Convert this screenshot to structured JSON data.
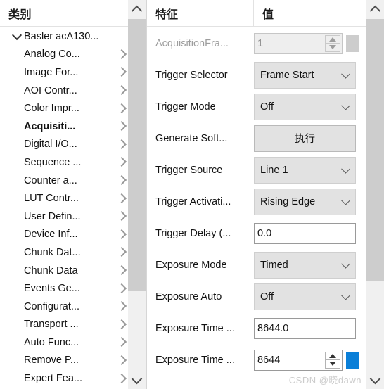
{
  "colors": {
    "accent_chip": "#0a7fd8",
    "scrollbar_thumb": "#cdcdcd",
    "scrollbar_track": "#f0f0f0",
    "combo_bg": "#e2e2e2",
    "text": "#121212",
    "disabled_text": "#9d9d9d"
  },
  "left_panel": {
    "header": "类别",
    "tree": [
      {
        "label": "Basler acA130...",
        "expander": "chevron-down",
        "has_children_arrow": false,
        "bold": false
      },
      {
        "label": "Analog Co...",
        "expander": "",
        "has_children_arrow": true,
        "bold": false
      },
      {
        "label": "Image For...",
        "expander": "",
        "has_children_arrow": true,
        "bold": false
      },
      {
        "label": "AOI Contr...",
        "expander": "",
        "has_children_arrow": true,
        "bold": false
      },
      {
        "label": "Color Impr...",
        "expander": "",
        "has_children_arrow": true,
        "bold": false
      },
      {
        "label": "Acquisiti...",
        "expander": "",
        "has_children_arrow": true,
        "bold": true
      },
      {
        "label": "Digital I/O...",
        "expander": "",
        "has_children_arrow": true,
        "bold": false
      },
      {
        "label": "Sequence ...",
        "expander": "",
        "has_children_arrow": true,
        "bold": false
      },
      {
        "label": "Counter a...",
        "expander": "",
        "has_children_arrow": true,
        "bold": false
      },
      {
        "label": "LUT Contr...",
        "expander": "",
        "has_children_arrow": true,
        "bold": false
      },
      {
        "label": "User Defin...",
        "expander": "",
        "has_children_arrow": true,
        "bold": false
      },
      {
        "label": "Device Inf...",
        "expander": "",
        "has_children_arrow": true,
        "bold": false
      },
      {
        "label": "Chunk Dat...",
        "expander": "",
        "has_children_arrow": true,
        "bold": false
      },
      {
        "label": "Chunk Data",
        "expander": "",
        "has_children_arrow": true,
        "bold": false
      },
      {
        "label": "Events Ge...",
        "expander": "",
        "has_children_arrow": true,
        "bold": false
      },
      {
        "label": "Configurat...",
        "expander": "",
        "has_children_arrow": true,
        "bold": false
      },
      {
        "label": "Transport ...",
        "expander": "",
        "has_children_arrow": true,
        "bold": false
      },
      {
        "label": "Auto Func...",
        "expander": "",
        "has_children_arrow": true,
        "bold": false
      },
      {
        "label": "Remove P...",
        "expander": "",
        "has_children_arrow": true,
        "bold": false
      },
      {
        "label": "Expert Fea...",
        "expander": "",
        "has_children_arrow": true,
        "bold": false
      }
    ],
    "scrollbar": {
      "up_icon": "chevron-up-icon",
      "down_icon": "chevron-down-icon"
    }
  },
  "right_panel": {
    "header_feature": "特征",
    "header_value": "值",
    "rows": [
      {
        "name": "AcquisitionFra...",
        "type": "spinner",
        "value": "1",
        "disabled": true,
        "chip": null
      },
      {
        "name": "Trigger Selector",
        "type": "combo",
        "value": "Frame Start",
        "disabled": false,
        "chip": null
      },
      {
        "name": "Trigger Mode",
        "type": "combo",
        "value": "Off",
        "disabled": false,
        "chip": null
      },
      {
        "name": "Generate Soft...",
        "type": "button",
        "value": "执行",
        "disabled": false,
        "chip": null
      },
      {
        "name": "Trigger Source",
        "type": "combo",
        "value": "Line 1",
        "disabled": false,
        "chip": null
      },
      {
        "name": "Trigger Activati...",
        "type": "combo",
        "value": "Rising Edge",
        "disabled": false,
        "chip": null
      },
      {
        "name": "Trigger Delay (...",
        "type": "textbox",
        "value": "0.0",
        "disabled": false,
        "chip": null
      },
      {
        "name": "Exposure Mode",
        "type": "combo",
        "value": "Timed",
        "disabled": false,
        "chip": null
      },
      {
        "name": "Exposure Auto",
        "type": "combo",
        "value": "Off",
        "disabled": false,
        "chip": null
      },
      {
        "name": "Exposure Time ...",
        "type": "textbox",
        "value": "8644.0",
        "disabled": false,
        "chip": null
      },
      {
        "name": "Exposure Time ...",
        "type": "spinner",
        "value": "8644",
        "disabled": false,
        "chip": "#0a7fd8"
      }
    ],
    "scrollbar": {
      "up_icon": "chevron-up-icon",
      "down_icon": "chevron-down-icon"
    }
  },
  "watermark": "CSDN @晓dawn"
}
